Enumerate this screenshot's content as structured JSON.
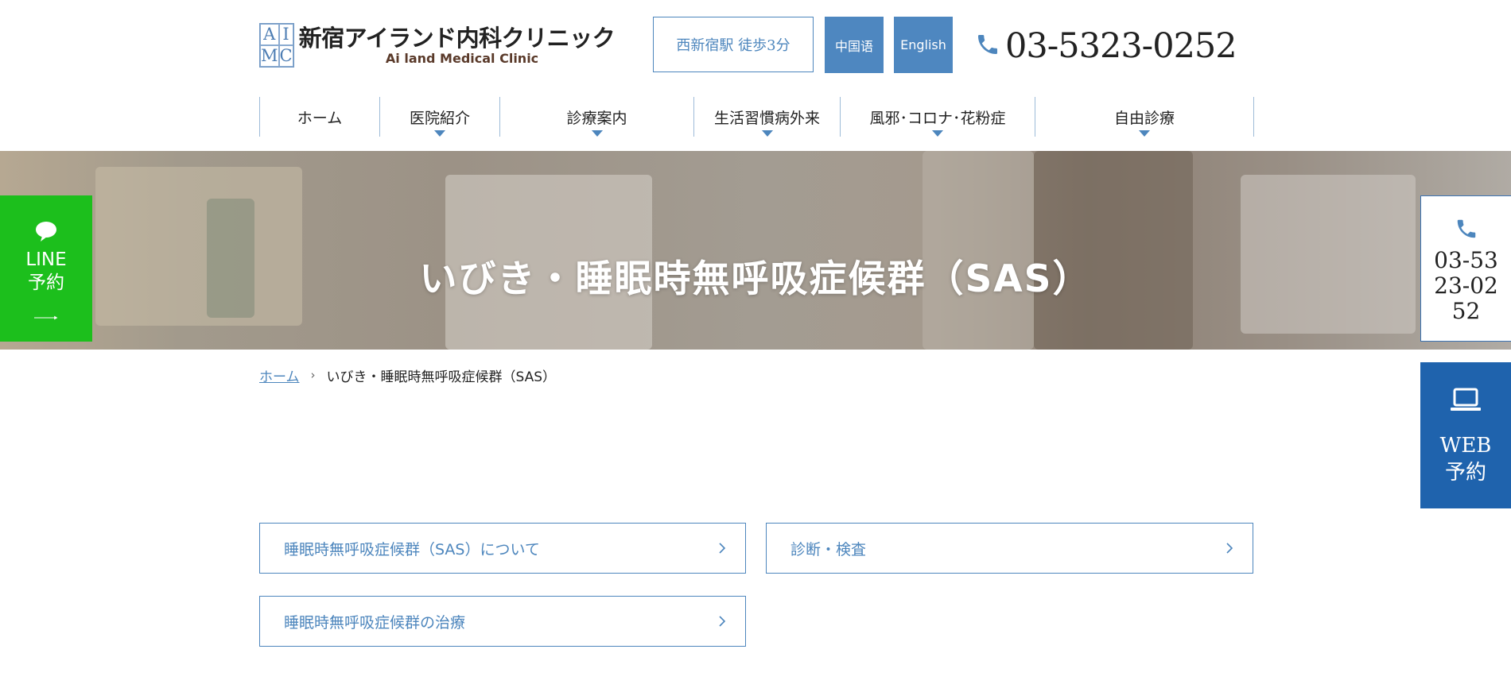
{
  "header": {
    "logo_mark": [
      "A",
      "I",
      "M",
      "C"
    ],
    "logo_ja": "新宿アイランド内科クリニック",
    "logo_en": "Ai land Medical Clinic",
    "station_label": "西新宿駅 徒歩3分",
    "lang_cn": "中国语",
    "lang_en": "English",
    "phone": "03-5323-0252"
  },
  "nav": {
    "items": [
      {
        "label": "ホーム",
        "dropdown": false
      },
      {
        "label": "医院紹介",
        "dropdown": true
      },
      {
        "label": "診療案内",
        "dropdown": true
      },
      {
        "label": "生活習慣病外来",
        "dropdown": true
      },
      {
        "label": "風邪･コロナ･花粉症",
        "dropdown": true
      },
      {
        "label": "自由診療",
        "dropdown": true
      }
    ]
  },
  "hero": {
    "title": "いびき・睡眠時無呼吸症候群（SAS）"
  },
  "side": {
    "line_label": "LINE\n予約",
    "phone": "03-5323-0252",
    "web_label": "WEB\n予約"
  },
  "breadcrumb": {
    "home": "ホーム",
    "separator": "›",
    "current": "いびき・睡眠時無呼吸症候群（SAS）"
  },
  "anchors": [
    {
      "label": "睡眠時無呼吸症候群（SAS）について"
    },
    {
      "label": "診断・検査"
    },
    {
      "label": "睡眠時無呼吸症候群の治療"
    }
  ],
  "colors": {
    "accent": "#4d86bd",
    "line_green": "#1cbf1c",
    "web_blue": "#1f63ad"
  },
  "icons": {
    "phone": "phone-icon",
    "line": "chat-bubble-icon",
    "web": "laptop-icon",
    "anchor": "chevron-right-icon"
  }
}
